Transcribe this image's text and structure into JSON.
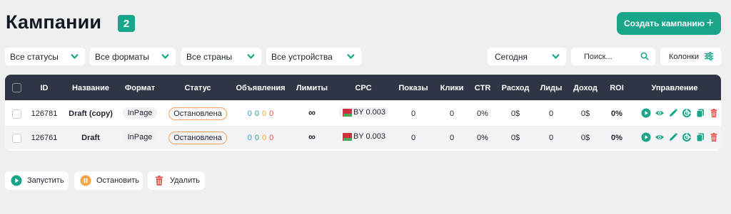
{
  "header": {
    "title": "Кампании",
    "count": "2",
    "create_label": "Создать кампанию",
    "create_icon": "plus-icon",
    "accent_color": "#18a58a"
  },
  "filters": [
    {
      "label": "Все статусы",
      "icon": "chevron-down-icon"
    },
    {
      "label": "Все форматы",
      "icon": "chevron-down-icon"
    },
    {
      "label": "Все страны",
      "icon": "chevron-down-icon"
    },
    {
      "label": "Все устройства",
      "icon": "chevron-down-icon"
    }
  ],
  "period": {
    "label": "Сегодня",
    "icon": "chevron-down-icon"
  },
  "search": {
    "placeholder": "Поиск...",
    "icon": "search-icon"
  },
  "columns_button": {
    "label": "Колонки",
    "icon": "sliders-icon"
  },
  "table": {
    "header_bg": "#2f3544",
    "columns": [
      "ID",
      "Название",
      "Формат",
      "Статус",
      "Объявления",
      "Лимиты",
      "CPC",
      "Показы",
      "Клики",
      "CTR",
      "Расход",
      "Лиды",
      "Доход",
      "ROI",
      "Управление"
    ],
    "rows": [
      {
        "id": "126781",
        "name": "Draft (copy)",
        "format": "InPage",
        "status": "Остановлена",
        "ads": [
          "0",
          "0",
          "0",
          "0"
        ],
        "limits": "∞",
        "cpc": "BY 0.003",
        "impressions": "0",
        "clicks": "0",
        "ctr": "0%",
        "spend": "0$",
        "leads": "0",
        "revenue": "0$",
        "roi": "0%"
      },
      {
        "id": "126761",
        "name": "Draft",
        "format": "InPage",
        "status": "Остановлена",
        "ads": [
          "0",
          "0",
          "0",
          "0"
        ],
        "limits": "∞",
        "cpc": "BY 0.003",
        "impressions": "0",
        "clicks": "0",
        "ctr": "0%",
        "spend": "0$",
        "leads": "0",
        "revenue": "0$",
        "roi": "0%"
      }
    ],
    "row_actions": [
      "play-icon",
      "eye-icon",
      "pencil-icon",
      "stats-icon",
      "copy-icon",
      "trash-icon"
    ],
    "status_color": "#f0a25c",
    "ads_colors": [
      "#1aa0d8",
      "#1aa58a",
      "#f3a545",
      "#e4524b"
    ]
  },
  "bulk_actions": [
    {
      "label": "Запустить",
      "icon": "play-icon",
      "color": "#18a58a"
    },
    {
      "label": "Остановить",
      "icon": "pause-icon",
      "color": "#f3a545"
    },
    {
      "label": "Удалить",
      "icon": "trash-icon",
      "color": "#e4524b"
    }
  ]
}
